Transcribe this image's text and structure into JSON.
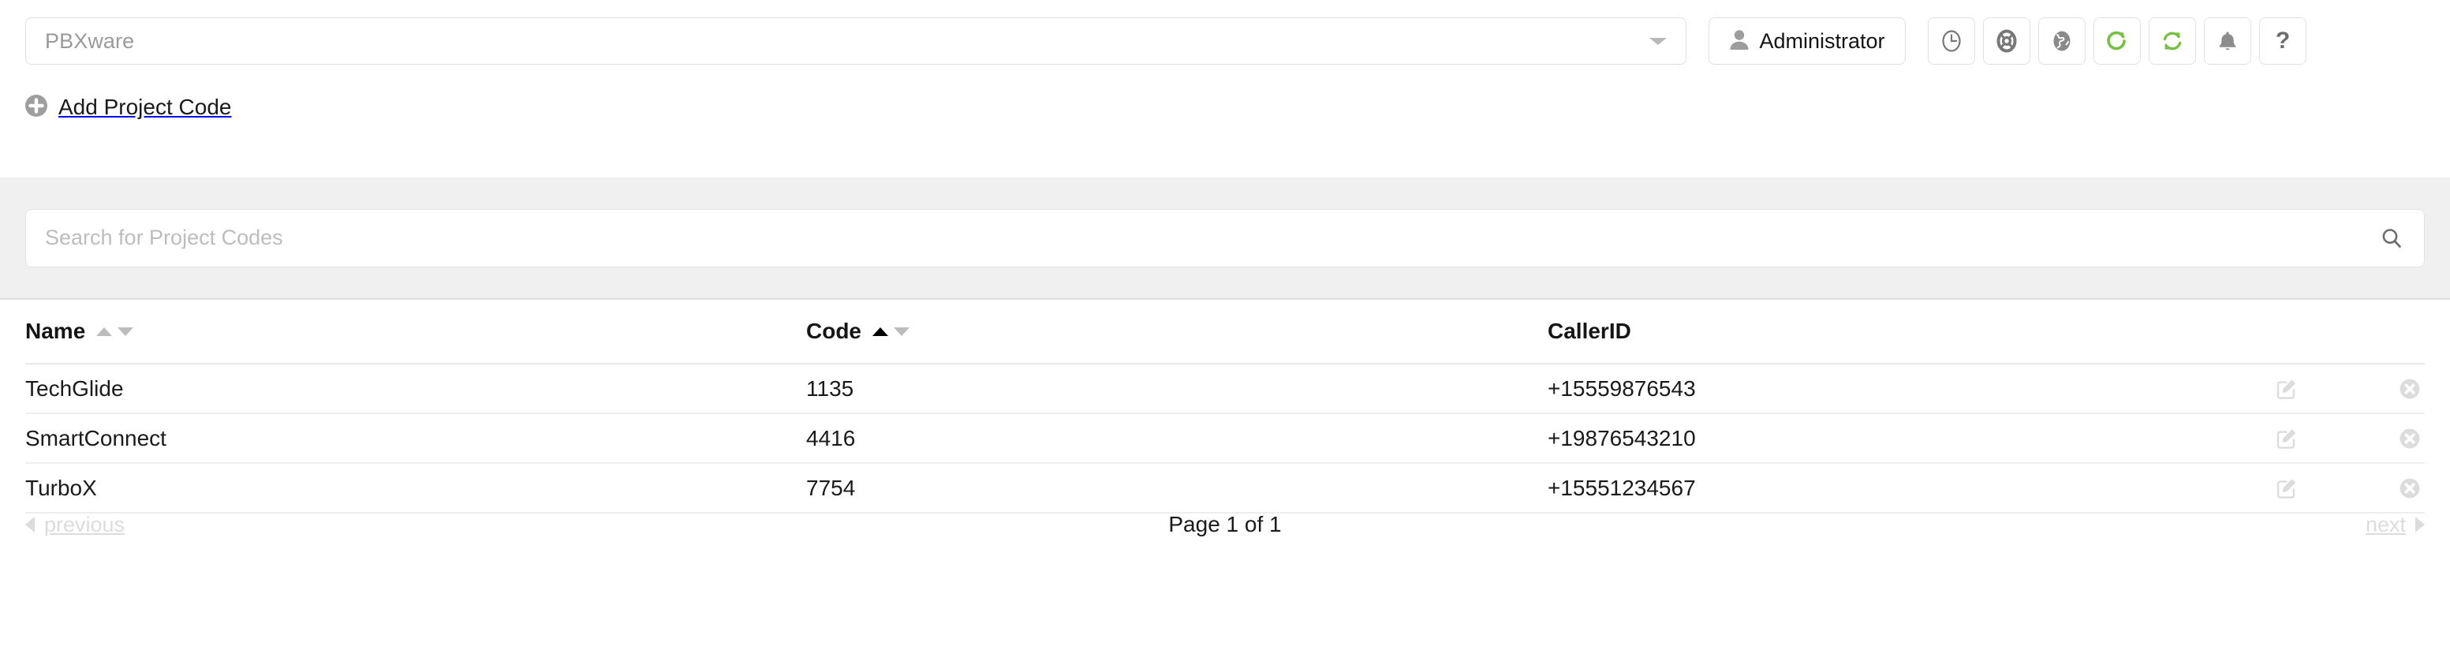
{
  "topbar": {
    "server_select": {
      "value": "PBXware",
      "caret": "chevron-down-icon"
    },
    "admin_button": {
      "label": "Administrator",
      "icon": "user-icon"
    },
    "icons": [
      {
        "name": "clock-icon",
        "title": "Clock"
      },
      {
        "name": "lifebuoy-icon",
        "title": "Support"
      },
      {
        "name": "globe-icon",
        "title": "Language"
      },
      {
        "name": "reload-icon",
        "title": "Reload",
        "color": "#76c043"
      },
      {
        "name": "sync-icon",
        "title": "Sync",
        "color": "#76c043"
      },
      {
        "name": "bell-icon",
        "title": "Notifications"
      },
      {
        "name": "help-icon",
        "title": "Help",
        "glyph": "?"
      }
    ]
  },
  "actions": {
    "add_project_code": {
      "label": "Add Project Code",
      "icon": "plus-circle-icon"
    }
  },
  "search": {
    "value": "",
    "placeholder": "Search for Project Codes",
    "icon": "search-icon"
  },
  "table": {
    "columns": [
      {
        "key": "name",
        "label": "Name",
        "sortable": true,
        "sort": "none"
      },
      {
        "key": "code",
        "label": "Code",
        "sortable": true,
        "sort": "asc"
      },
      {
        "key": "callerid",
        "label": "CallerID",
        "sortable": false,
        "sort": "none"
      }
    ],
    "rows": [
      {
        "name": "TechGlide",
        "code": "1135",
        "callerid": "+15559876543",
        "edit_icon": "edit-pencil-icon",
        "delete_icon": "delete-circle-x-icon"
      },
      {
        "name": "SmartConnect",
        "code": "4416",
        "callerid": "+19876543210",
        "edit_icon": "edit-pencil-icon",
        "delete_icon": "delete-circle-x-icon"
      },
      {
        "name": "TurboX",
        "code": "7754",
        "callerid": "+15551234567",
        "edit_icon": "edit-pencil-icon",
        "delete_icon": "delete-circle-x-icon"
      }
    ]
  },
  "pagination": {
    "previous_label": "previous",
    "next_label": "next",
    "page_status": "Page 1 of 1",
    "previous_enabled": false,
    "next_enabled": false
  },
  "colors": {
    "accent_green": "#76c043",
    "band_gray": "#f0f0f0",
    "text_primary": "#1a1a1a",
    "text_muted": "#bdbdbd",
    "border": "#e0e0e0"
  }
}
